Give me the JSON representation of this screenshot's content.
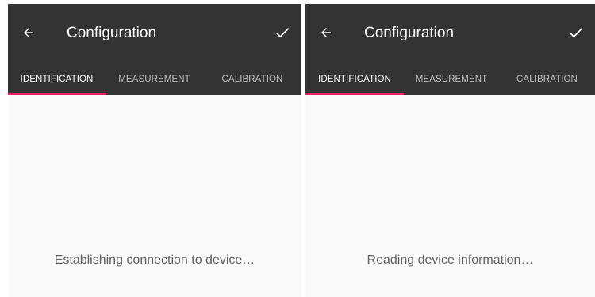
{
  "screens": [
    {
      "title": "Configuration",
      "tabs": [
        {
          "label": "IDENTIFICATION",
          "active": true
        },
        {
          "label": "MEASUREMENT",
          "active": false
        },
        {
          "label": "CALIBRATION",
          "active": false
        }
      ],
      "status": "Establishing connection to device…"
    },
    {
      "title": "Configuration",
      "tabs": [
        {
          "label": "IDENTIFICATION",
          "active": true
        },
        {
          "label": "MEASUREMENT",
          "active": false
        },
        {
          "label": "CALIBRATION",
          "active": false
        }
      ],
      "status": "Reading device information…"
    }
  ],
  "icons": {
    "back": "arrow-left-icon",
    "confirm": "check-icon"
  },
  "colors": {
    "appbar": "#333333",
    "tab_indicator": "#e91e63",
    "background": "#fafafa",
    "status_text": "#616161"
  }
}
